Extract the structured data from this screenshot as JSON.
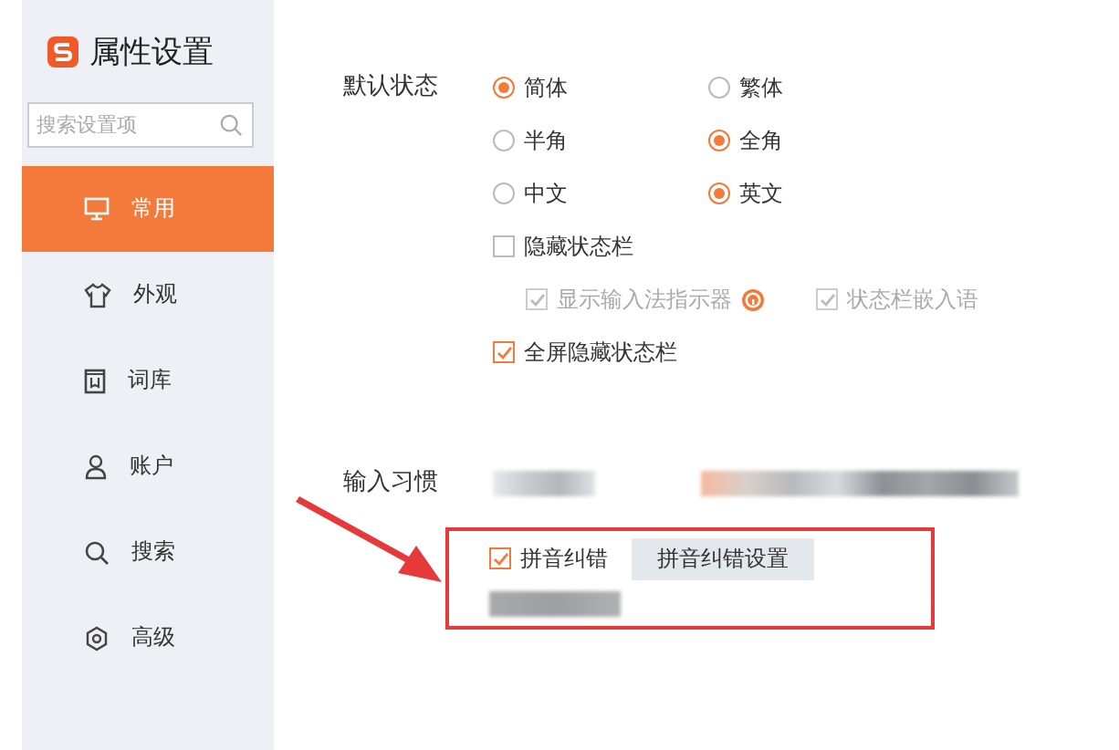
{
  "app": {
    "title": "属性设置",
    "search": {
      "placeholder": "搜索设置项"
    }
  },
  "sidebar": {
    "items": [
      {
        "label": "常用",
        "selected": true
      },
      {
        "label": "外观",
        "selected": false
      },
      {
        "label": "词库",
        "selected": false
      },
      {
        "label": "账户",
        "selected": false
      },
      {
        "label": "搜索",
        "selected": false
      },
      {
        "label": "高级",
        "selected": false
      }
    ]
  },
  "default_state": {
    "label": "默认状态",
    "radio_rows": [
      [
        {
          "label": "简体",
          "selected": true
        },
        {
          "label": "繁体",
          "selected": false
        }
      ],
      [
        {
          "label": "半角",
          "selected": false
        },
        {
          "label": "全角",
          "selected": true
        }
      ],
      [
        {
          "label": "中文",
          "selected": false
        },
        {
          "label": "英文",
          "selected": true
        }
      ]
    ],
    "hide_status_bar": {
      "label": "隐藏状态栏",
      "checked": false
    },
    "sub_options": [
      {
        "label": "显示输入法指示器",
        "checked": true,
        "disabled": true,
        "help": true
      },
      {
        "label": "状态栏嵌入语",
        "checked": true,
        "disabled": true,
        "help": false
      }
    ],
    "fullscreen_hide": {
      "label": "全屏隐藏状态栏",
      "checked": true
    }
  },
  "input_habits": {
    "label": "输入习惯",
    "pinyin_correction": {
      "label": "拼音纠错",
      "checked": true
    },
    "settings_button": "拼音纠错设置"
  }
}
